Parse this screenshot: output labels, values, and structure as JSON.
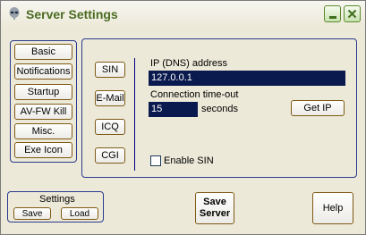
{
  "window": {
    "title": "Server Settings",
    "app_icon": "alien-icon",
    "minimize_icon": "minimize-icon",
    "close_icon": "close-icon"
  },
  "left_tabs": [
    "Basic",
    "Notifications",
    "Startup",
    "AV-FW Kill",
    "Misc.",
    "Exe Icon"
  ],
  "notify_tabs": [
    "SIN",
    "E-Mail",
    "ICQ",
    "CGI"
  ],
  "sin": {
    "ip_label": "IP (DNS) address",
    "ip_value": "127.0.0.1",
    "timeout_label": "Connection time-out",
    "timeout_value": "15",
    "timeout_unit": "seconds",
    "get_ip_label": "Get IP",
    "enable_label": "Enable SIN",
    "enable_checked": false
  },
  "settings_group": {
    "title": "Settings",
    "save_label": "Save",
    "load_label": "Load"
  },
  "save_server": {
    "line1": "Save",
    "line2": "Server"
  },
  "help_label": "Help",
  "colors": {
    "title_text": "#4a6b22",
    "field_bg": "#0a1a4e",
    "group_border": "#2b3a8e",
    "button_border": "#7f5a16"
  }
}
